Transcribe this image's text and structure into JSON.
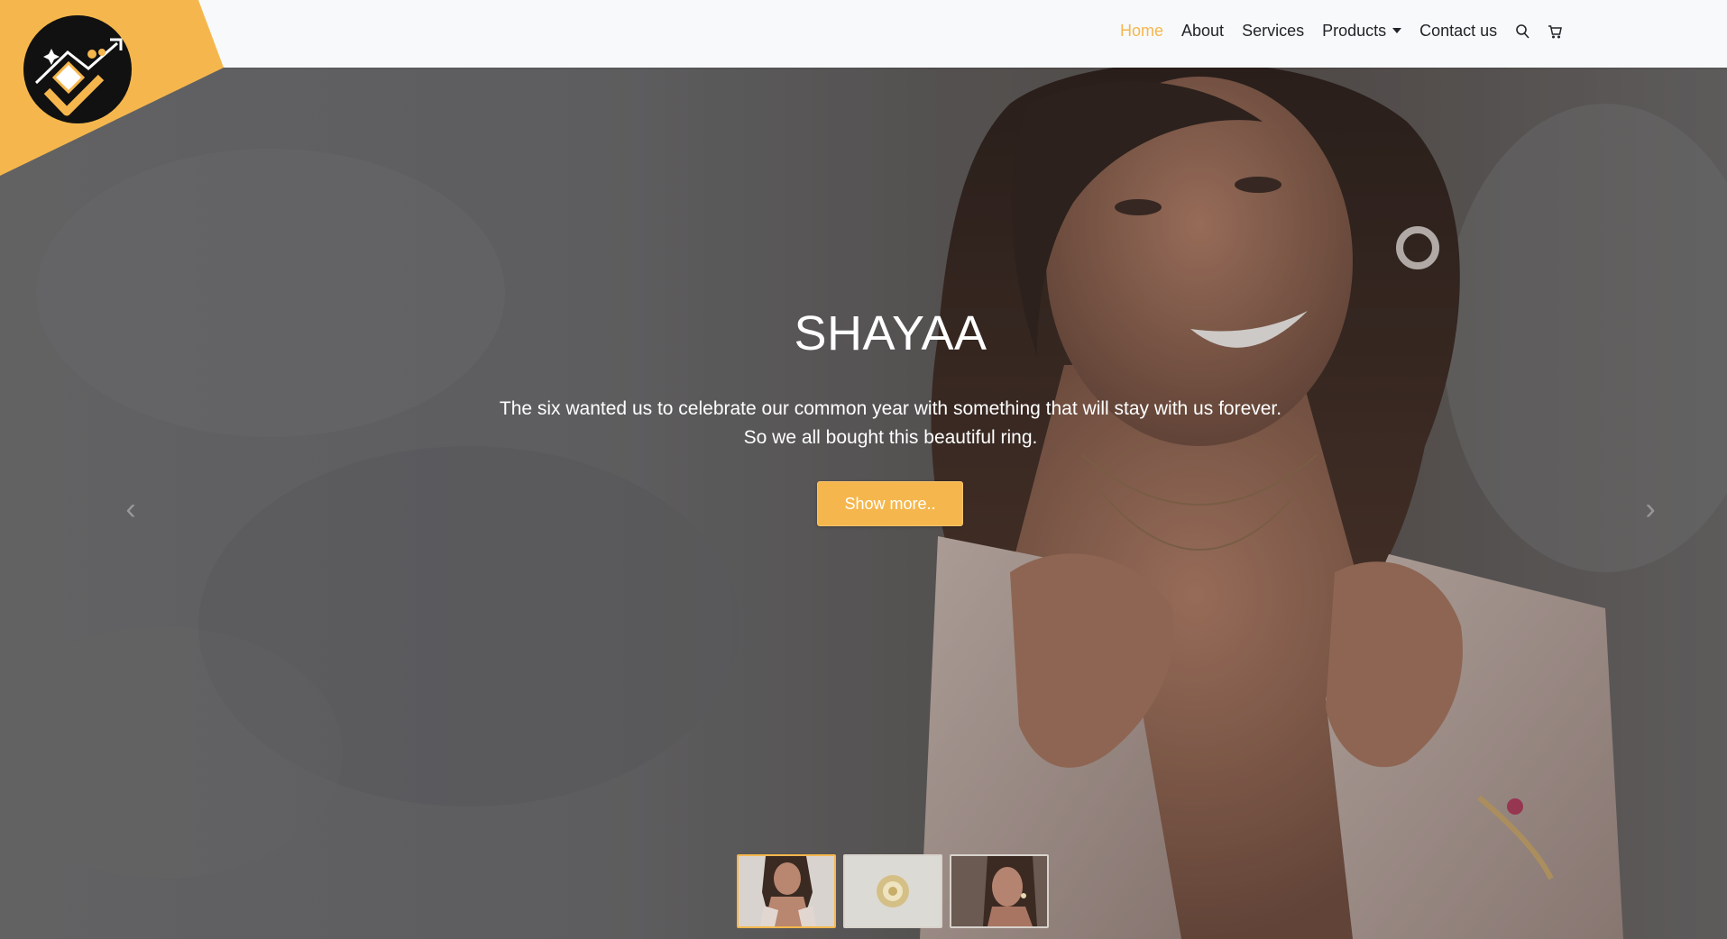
{
  "header": {
    "nav": {
      "home": "Home",
      "about": "About",
      "services": "Services",
      "products": "Products",
      "contact": "Contact us"
    },
    "icons": [
      "search-icon",
      "cart-icon"
    ],
    "accent_color": "#f5b74d"
  },
  "hero": {
    "title": "SHAYAA",
    "text_line1": "The six wanted us to celebrate our common year with something that will stay with us forever.",
    "text_line2": "So we all bought this beautiful ring.",
    "button_label": "Show more..",
    "arrow_prev": "‹",
    "arrow_next": "›",
    "thumbnails": [
      {
        "name": "thumbnail-model-necklace",
        "active": true
      },
      {
        "name": "thumbnail-ring",
        "active": false
      },
      {
        "name": "thumbnail-model-earring",
        "active": false
      }
    ]
  }
}
